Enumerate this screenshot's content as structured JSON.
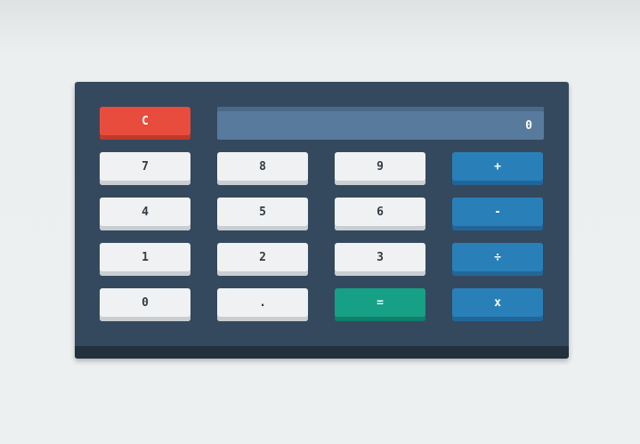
{
  "display": {
    "value": "0"
  },
  "keys": {
    "clear": "C",
    "seven": "7",
    "eight": "8",
    "nine": "9",
    "add": "+",
    "four": "4",
    "five": "5",
    "six": "6",
    "subtract": "-",
    "one": "1",
    "two": "2",
    "three": "3",
    "divide": "÷",
    "zero": "0",
    "decimal": ".",
    "equals": "=",
    "multiply": "x"
  },
  "colors": {
    "body": "#34495e",
    "display": "#587a9d",
    "number_key": "#f0f1f2",
    "operator_key": "#2980b9",
    "clear_key": "#e74c3c",
    "equals_key": "#16a085"
  }
}
